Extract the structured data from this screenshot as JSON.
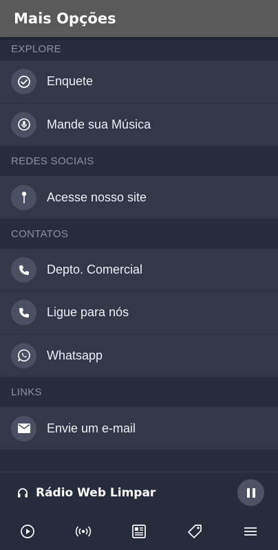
{
  "header": {
    "title": "Mais Opções"
  },
  "sections": {
    "explore": {
      "title": "EXPLORE",
      "items": [
        {
          "label": "Enquete",
          "icon": "check-circle-icon"
        },
        {
          "label": "Mande sua Música",
          "icon": "microphone-icon"
        }
      ]
    },
    "social": {
      "title": "REDES SOCIAIS",
      "items": [
        {
          "label": "Acesse nosso site",
          "icon": "pin-icon"
        }
      ]
    },
    "contacts": {
      "title": "CONTATOS",
      "items": [
        {
          "label": "Depto. Comercial",
          "icon": "phone-icon"
        },
        {
          "label": "Ligue para nós",
          "icon": "phone-icon"
        },
        {
          "label": "Whatsapp",
          "icon": "whatsapp-icon"
        }
      ]
    },
    "links": {
      "title": "LINKS",
      "items": [
        {
          "label": "Envie um e-mail",
          "icon": "envelope-icon"
        }
      ]
    }
  },
  "player": {
    "station_name": "Rádio Web Limpar",
    "state": "playing"
  },
  "bottom_nav": {
    "items": [
      "play-icon",
      "broadcast-icon",
      "news-icon",
      "tag-icon",
      "menu-icon"
    ]
  },
  "colors": {
    "app_bar": "#595959",
    "background": "#262c3b",
    "item_background": "#323848",
    "icon_circle": "#4a5062",
    "section_text": "#8a91a3"
  }
}
